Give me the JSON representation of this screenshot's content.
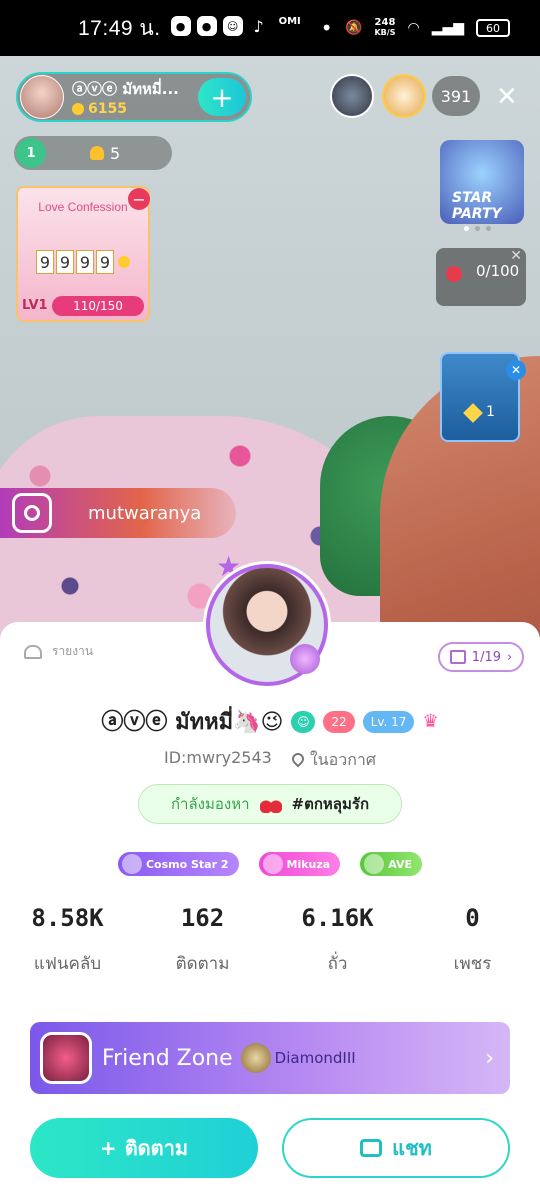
{
  "status_bar": {
    "time": "17:49 น.",
    "app_icons": [
      "chat-bubble-icon",
      "chat-bubble-icon",
      "bigo-icon",
      "tiktok-icon"
    ],
    "omi": "OMI",
    "net_speed_value": "248",
    "net_speed_unit": "KB/S",
    "battery": "60"
  },
  "host": {
    "name": "ⓐⓥⓔ มัทหมี่...",
    "coins": "6155",
    "add_label": "+"
  },
  "viewers": {
    "count": "391",
    "close_label": "✕"
  },
  "level": {
    "badge": "1",
    "fans": "5"
  },
  "love_confession": {
    "title": "Love Confession",
    "digits": [
      "9",
      "9",
      "9",
      "9"
    ],
    "level": "LV1",
    "progress_text": "110/150"
  },
  "star_party": {
    "label": "STAR PARTY"
  },
  "rose_goal": {
    "text": "0/100"
  },
  "gem": {
    "count": "1"
  },
  "instagram": {
    "handle": "mutwaranya"
  },
  "profile": {
    "report_label": "รายงาน",
    "gift_pager": "1/19",
    "name": "ⓐⓥⓔ มัทหมี่🦄😉",
    "tag_red": "22",
    "tag_level": "Lv. 17",
    "id": "ID:mwry2543",
    "location": "ในอวกาศ",
    "looking_label": "กำลังมองหา",
    "looking_hashtag": "#ตกหลุมรัก",
    "badges": [
      "Cosmo Star 2",
      "Mikuza",
      "AVE"
    ],
    "stats": [
      {
        "value": "8.58K",
        "label": "แฟนคลับ"
      },
      {
        "value": "162",
        "label": "ติดตาม"
      },
      {
        "value": "6.16K",
        "label": "ถั่ว"
      },
      {
        "value": "0",
        "label": "เพชร"
      }
    ],
    "friend_zone_title": "Friend Zone",
    "friend_zone_rank": "DiamondIII",
    "follow_label": "ติดตาม",
    "chat_label": "แชท"
  },
  "colors": {
    "accent": "#2ee6c7",
    "purple": "#b367e8",
    "pink": "#ff4f9a"
  }
}
